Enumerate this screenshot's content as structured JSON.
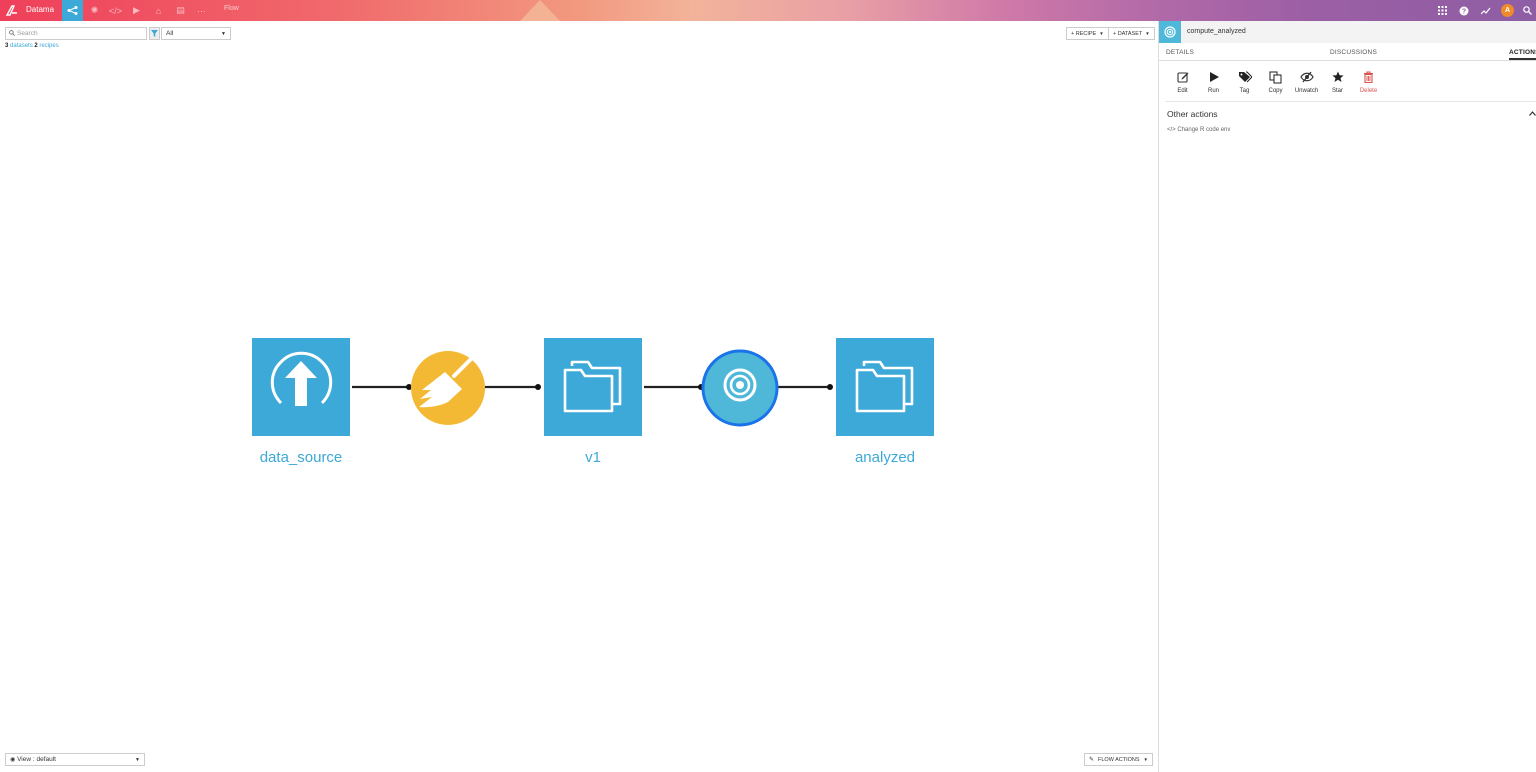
{
  "nav": {
    "project_name": "Datama",
    "flow_label": "Flow",
    "avatar_letter": "A",
    "brand_color": "#ef3f5a",
    "active_color": "#3da9d8"
  },
  "filter": {
    "search_placeholder": "Search",
    "filter_value": "All",
    "dataset_count": "3",
    "dataset_label": "datasets",
    "recipe_count": "2",
    "recipe_label": "recipes"
  },
  "toolbar": {
    "recipe_label": "+ RECIPE",
    "dataset_label": "+ DATASET"
  },
  "flow": {
    "nodes": [
      {
        "name": "data_source",
        "kind": "dataset",
        "icon": "upload-icon",
        "color": "#3da9d8"
      },
      {
        "name": "",
        "kind": "recipe",
        "icon": "broom-icon",
        "color": "#f4b934"
      },
      {
        "name": "v1",
        "kind": "dataset",
        "icon": "folder-icon",
        "color": "#3da9d8"
      },
      {
        "name": "",
        "kind": "recipe",
        "icon": "target-icon",
        "color": "#4fb8d8"
      },
      {
        "name": "analyzed",
        "kind": "dataset",
        "icon": "folder-icon",
        "color": "#3da9d8"
      }
    ]
  },
  "bottom": {
    "view_label": "View : default",
    "flow_actions_label": "FLOW ACTIONS"
  },
  "panel": {
    "title": "compute_analyzed",
    "tabs": [
      "DETAILS",
      "DISCUSSIONS",
      "ACTIONS"
    ],
    "actions": [
      {
        "label": "Edit",
        "icon": "edit-icon"
      },
      {
        "label": "Run",
        "icon": "play-icon"
      },
      {
        "label": "Tag",
        "icon": "tag-icon"
      },
      {
        "label": "Copy",
        "icon": "copy-icon"
      },
      {
        "label": "Unwatch",
        "icon": "unwatch-icon"
      },
      {
        "label": "Star",
        "icon": "star-icon"
      },
      {
        "label": "Delete",
        "icon": "trash-icon"
      }
    ],
    "other_actions_title": "Other actions",
    "change_env_label": "Change R code env",
    "delete_color": "#d9534f"
  }
}
